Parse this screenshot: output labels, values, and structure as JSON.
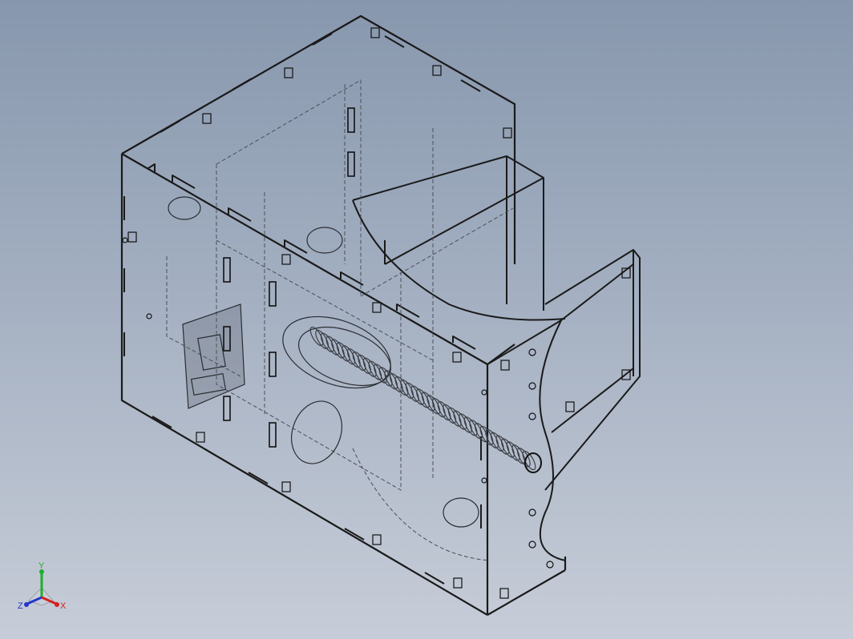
{
  "viewport": {
    "background_top": "#8797ad",
    "background_bottom": "#c7cdd8"
  },
  "model": {
    "description_icon": "transparent-box-assembly-icon",
    "edge_color": "#1a1a1a",
    "hidden_edge_color": "#4a4f5a"
  },
  "triad": {
    "x_label": "X",
    "y_label": "Y",
    "z_label": "Z",
    "x_color": "#d42020",
    "y_color": "#1fae2a",
    "z_color": "#2238c8"
  }
}
